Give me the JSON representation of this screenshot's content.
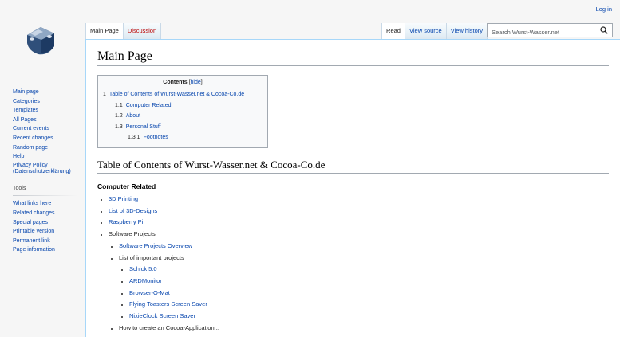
{
  "personal": {
    "login": "Log in"
  },
  "sidebar": {
    "nav": [
      "Main page",
      "Categories",
      "Templates",
      "All Pages",
      "Current events",
      "Recent changes",
      "Random page",
      "Help",
      "Privacy Policy (Datenschutzerklärung)"
    ],
    "tools_heading": "Tools",
    "tools": [
      "What links here",
      "Related changes",
      "Special pages",
      "Printable version",
      "Permanent link",
      "Page information"
    ]
  },
  "tabs": {
    "main_page": "Main Page",
    "discussion": "Discussion",
    "read": "Read",
    "view_source": "View source",
    "view_history": "View history"
  },
  "search": {
    "placeholder": "Search Wurst-Wasser.net"
  },
  "page": {
    "title": "Main Page",
    "toc": {
      "title": "Contents",
      "hide": "hide",
      "items": [
        {
          "num": "1",
          "label": "Table of Contents of Wurst-Wasser.net & Cocoa-Co.de"
        },
        {
          "num": "1.1",
          "label": "Computer Related"
        },
        {
          "num": "1.2",
          "label": "About"
        },
        {
          "num": "1.3",
          "label": "Personal Stuff"
        },
        {
          "num": "1.3.1",
          "label": "Footnotes"
        }
      ]
    },
    "section_heading": "Table of Contents of Wurst-Wasser.net & Cocoa-Co.de",
    "subsection_heading": "Computer Related",
    "items": {
      "printing": "3D Printing",
      "designs": "List of 3D-Designs",
      "raspberry": "Raspberry Pi",
      "software": "Software Projects",
      "software_overview": "Software Projects Overview",
      "important": "List of important projects",
      "schick": "Schick 5.0",
      "ardmonitor": "ARDMonitor",
      "browser": "Browser-O-Mat",
      "toasters": "Flying Toasters Screen Saver",
      "nixie": "NixieClock Screen Saver",
      "cocoa": "How to create an Cocoa-Application..."
    }
  }
}
